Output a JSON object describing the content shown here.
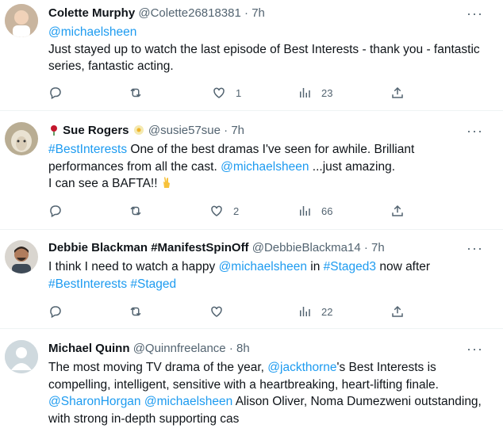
{
  "tweets": [
    {
      "name": "Colette Murphy",
      "name_suffix": "",
      "handle": "@Colette26818381",
      "time": "7h",
      "reply_to": "@michaelsheen",
      "text": "Just stayed up to watch the last episode of Best Interests - thank you - fantastic series, fantastic acting.",
      "likes": "1",
      "views": "23",
      "retweets": ""
    },
    {
      "name": "Sue Rogers",
      "name_prefix_icon": "rose-icon",
      "name_suffix_icon": "flower-icon",
      "handle": "@susie57sue",
      "time": "7h",
      "text_parts": {
        "hashtag": "#BestInterests",
        "t1": " One of the best dramas I've seen for awhile. Brilliant performances from all the cast. ",
        "mention": "@michaelsheen",
        "t2": " ...just amazing.",
        "t3": "I can see a BAFTA!! ",
        "emoji_icon": "fingers-crossed-icon"
      },
      "likes": "2",
      "views": "66"
    },
    {
      "name": "Debbie Blackman #ManifestSpinOff",
      "handle": "@DebbieBlackma14",
      "time": "7h",
      "text_parts": {
        "t1": "I think I need to watch a happy ",
        "mention": "@michaelsheen",
        "t2": " in ",
        "hashtag1": "#Staged3",
        "t3": " now after",
        "hashtag2": "#BestInterests",
        "t4": " ",
        "hashtag3": "#Staged"
      },
      "views": "22"
    },
    {
      "name": "Michael Quinn",
      "handle": "@Quinnfreelance",
      "time": "8h",
      "text_parts": {
        "t1": "The most moving TV drama of the year, ",
        "mention1": "@jackthorne",
        "t2": "'s Best Interests is compelling, intelligent, sensitive with a heartbreaking, heart-lifting finale.",
        "mention2": "@SharonHorgan",
        "t3": " ",
        "mention3": "@michaelsheen",
        "t4": " Alison Oliver, Noma Dumezweni outstanding, with strong in-depth supporting cas"
      }
    }
  ],
  "separator": "·",
  "colors": {
    "link": "#1d9bf0",
    "muted": "#536471",
    "text": "#0f1419"
  }
}
